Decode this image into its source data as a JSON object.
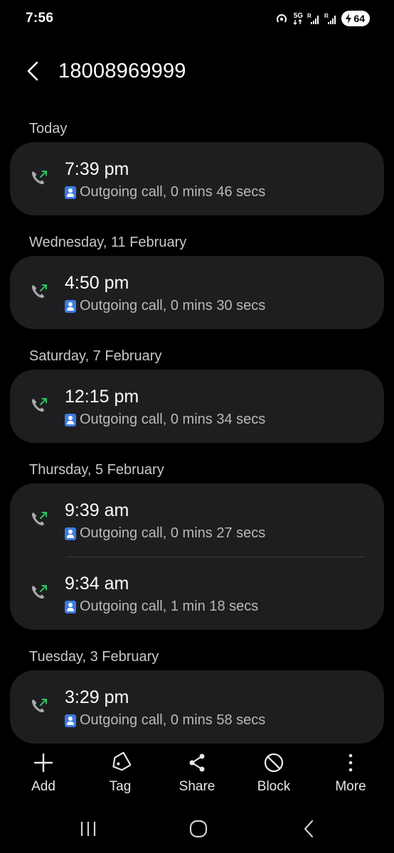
{
  "status_bar": {
    "time": "7:56",
    "battery": "64",
    "network": "5G"
  },
  "header": {
    "title": "18008969999",
    "back_icon": "chevron-left-icon"
  },
  "groups": [
    {
      "date": "Today",
      "entries": [
        {
          "time": "7:39 pm",
          "detail": "Outgoing call, 0 mins 46 secs"
        }
      ]
    },
    {
      "date": "Wednesday, 11 February",
      "entries": [
        {
          "time": "4:50 pm",
          "detail": "Outgoing call, 0 mins 30 secs"
        }
      ]
    },
    {
      "date": "Saturday, 7 February",
      "entries": [
        {
          "time": "12:15 pm",
          "detail": "Outgoing call, 0 mins 34 secs"
        }
      ]
    },
    {
      "date": "Thursday, 5 February",
      "entries": [
        {
          "time": "9:39 am",
          "detail": "Outgoing call, 0 mins 27 secs"
        },
        {
          "time": "9:34 am",
          "detail": "Outgoing call, 1 min 18 secs"
        }
      ]
    },
    {
      "date": "Tuesday, 3 February",
      "entries": [
        {
          "time": "3:29 pm",
          "detail": "Outgoing call, 0 mins 58 secs"
        }
      ]
    }
  ],
  "actions": [
    {
      "label": "Add",
      "icon": "plus-icon"
    },
    {
      "label": "Tag",
      "icon": "tag-icon"
    },
    {
      "label": "Share",
      "icon": "share-icon"
    },
    {
      "label": "Block",
      "icon": "block-icon"
    },
    {
      "label": "More",
      "icon": "more-vertical-icon"
    }
  ],
  "colors": {
    "background": "#000000",
    "card": "#1e1e20",
    "outgoing_arrow": "#2fbf63",
    "contact_badge": "#3d7be0"
  }
}
